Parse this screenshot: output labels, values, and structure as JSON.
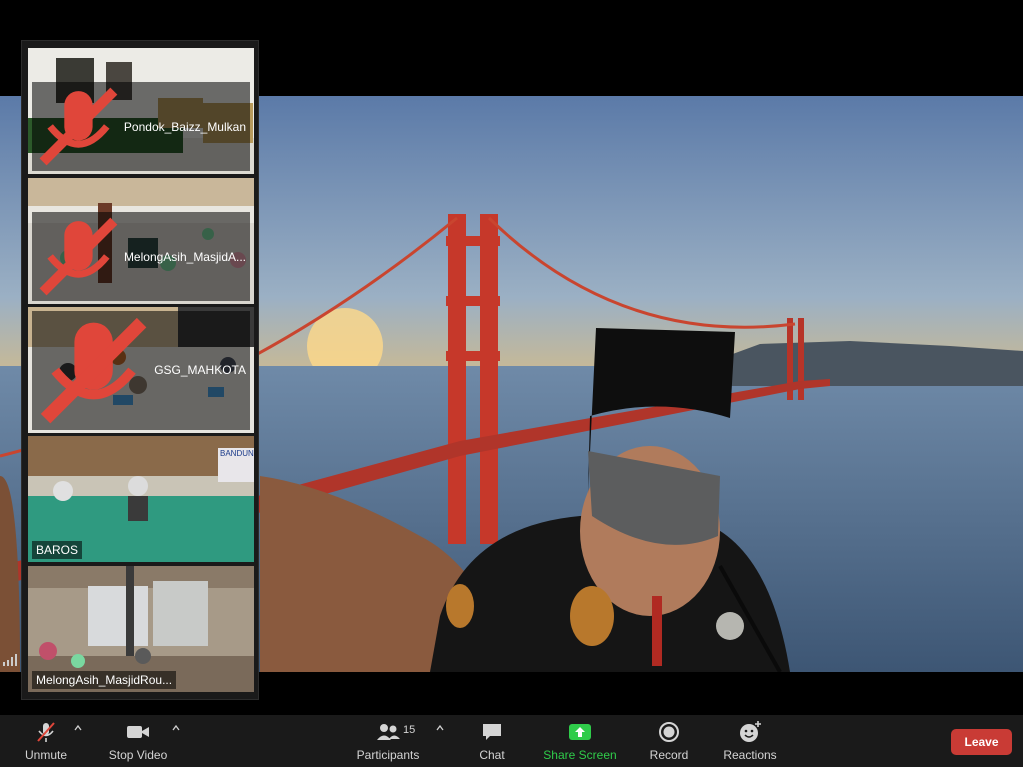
{
  "thumbnails": [
    {
      "name": "Pondok_Baizz_Mulkan",
      "muted": true
    },
    {
      "name": "MelongAsih_MasjidA...",
      "muted": true
    },
    {
      "name": "GSG_MAHKOTA",
      "muted": true
    },
    {
      "name": "BAROS",
      "muted": false
    },
    {
      "name": "MelongAsih_MasjidRou...",
      "muted": false
    }
  ],
  "toolbar": {
    "unmute_label": "Unmute",
    "stop_video_label": "Stop Video",
    "participants_label": "Participants",
    "participants_count": "15",
    "chat_label": "Chat",
    "share_screen_label": "Share Screen",
    "record_label": "Record",
    "reactions_label": "Reactions",
    "leave_label": "Leave"
  },
  "thumb_overlay_text": "BANDUN",
  "colors": {
    "toolbar_bg": "#1a1a1a",
    "share_green": "#2fcc4a",
    "leave_red": "#c93b35",
    "muted_red": "#e0463a"
  }
}
